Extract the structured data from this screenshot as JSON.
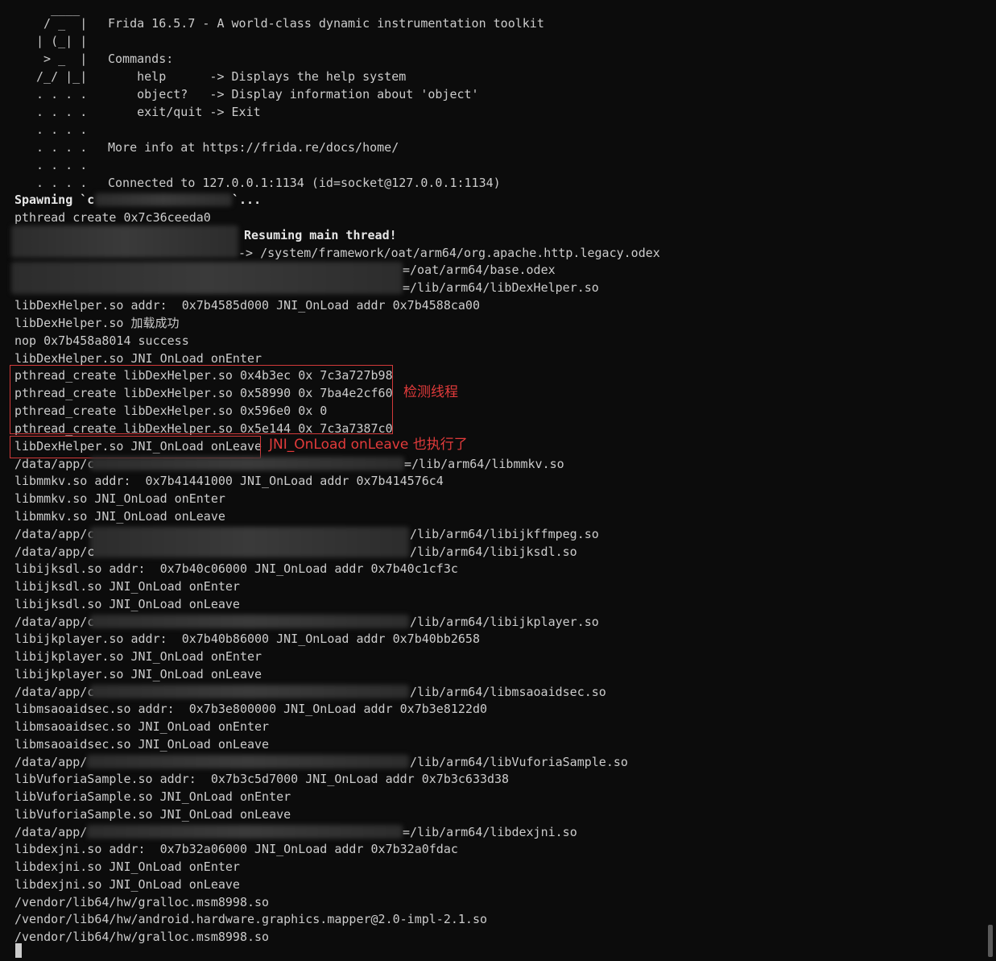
{
  "banner": {
    "ascii_art": [
      "   ____",
      "  / _  |",
      " | (_| |",
      "  > _  |",
      " /_/ |_|",
      " . . . .",
      " . . . .",
      " . . . .",
      " . . . .",
      " . . . .",
      " . . . ."
    ],
    "title": "Frida 16.5.7 - A world-class dynamic instrumentation toolkit",
    "commands_header": "Commands:",
    "commands": [
      "    help      -> Displays the help system",
      "    object?   -> Display information about 'object'",
      "    exit/quit -> Exit"
    ],
    "more_info": "More info at https://frida.re/docs/home/",
    "connected": "Connected to 127.0.0.1:1134 (id=socket@127.0.0.1:1134)"
  },
  "log": {
    "spawning_prefix": "Spawning `c",
    "spawning_suffix": "`...",
    "pthread_create": "pthread create 0x7c36ceeda0",
    "resuming": "Resuming main thread!",
    "legacy_odex": "-> /system/framework/oat/arm64/org.apache.http.legacy.odex",
    "base_odex": "=/oat/arm64/base.odex",
    "dexhelper_path": "=/lib/arm64/libDexHelper.so",
    "dexhelper_addr": "libDexHelper.so addr:  0x7b4585d000 JNI_OnLoad addr 0x7b4588ca00",
    "dexhelper_loaded": "libDexHelper.so 加载成功",
    "nop_line": "nop 0x7b458a8014 success",
    "dexhelper_onenter": "libDexHelper.so JNI_OnLoad onEnter",
    "pthread_lines": [
      "pthread_create libDexHelper.so 0x4b3ec 0x 7c3a727b98",
      "pthread_create libDexHelper.so 0x58990 0x 7ba4e2cf60",
      "pthread_create libDexHelper.so 0x596e0 0x 0",
      "pthread_create libDexHelper.so 0x5e144 0x 7c3a7387c0"
    ],
    "dexhelper_onleave": "libDexHelper.so JNI_OnLoad onLeave",
    "mmkv_prefix": "/data/app/c",
    "mmkv_suffix": "=/lib/arm64/libmmkv.so",
    "mmkv_addr": "libmmkv.so addr:  0x7b41441000 JNI_OnLoad addr 0x7b414576c4",
    "mmkv_onenter": "libmmkv.so JNI_OnLoad onEnter",
    "mmkv_onleave": "libmmkv.so JNI_OnLoad onLeave",
    "ffmpeg_prefix": "/data/app/c",
    "ffmpeg_suffix": "/lib/arm64/libijkffmpeg.so",
    "ijksdl_prefix": "/data/app/c",
    "ijksdl_suffix": "/lib/arm64/libijksdl.so",
    "ijksdl_addr": "libijksdl.so addr:  0x7b40c06000 JNI_OnLoad addr 0x7b40c1cf3c",
    "ijksdl_onenter": "libijksdl.so JNI_OnLoad onEnter",
    "ijksdl_onleave": "libijksdl.so JNI_OnLoad onLeave",
    "ijkplayer_prefix": "/data/app/c",
    "ijkplayer_suffix": "/lib/arm64/libijkplayer.so",
    "ijkplayer_addr": "libijkplayer.so addr:  0x7b40b86000 JNI_OnLoad addr 0x7b40bb2658",
    "ijkplayer_onenter": "libijkplayer.so JNI_OnLoad onEnter",
    "ijkplayer_onleave": "libijkplayer.so JNI_OnLoad onLeave",
    "msaoaidsec_prefix": "/data/app/c",
    "msaoaidsec_suffix": "/lib/arm64/libmsaoaidsec.so",
    "msaoaidsec_addr": "libmsaoaidsec.so addr:  0x7b3e800000 JNI_OnLoad addr 0x7b3e8122d0",
    "msaoaidsec_onenter": "libmsaoaidsec.so JNI_OnLoad onEnter",
    "msaoaidsec_onleave": "libmsaoaidsec.so JNI_OnLoad onLeave",
    "vuforia_prefix": "/data/app/",
    "vuforia_suffix": "/lib/arm64/libVuforiaSample.so",
    "vuforia_addr": "libVuforiaSample.so addr:  0x7b3c5d7000 JNI_OnLoad addr 0x7b3c633d38",
    "vuforia_onenter": "libVuforiaSample.so JNI_OnLoad onEnter",
    "vuforia_onleave": "libVuforiaSample.so JNI_OnLoad onLeave",
    "dexjni_prefix": "/data/app/",
    "dexjni_suffix": "=/lib/arm64/libdexjni.so",
    "dexjni_addr": "libdexjni.so addr:  0x7b32a06000 JNI_OnLoad addr 0x7b32a0fdac",
    "dexjni_onenter": "libdexjni.so JNI_OnLoad onEnter",
    "dexjni_onleave": "libdexjni.so JNI_OnLoad onLeave",
    "gralloc1": "/vendor/lib64/hw/gralloc.msm8998.so",
    "mapper": "/vendor/lib64/hw/android.hardware.graphics.mapper@2.0-impl-2.1.so",
    "gralloc2": "/vendor/lib64/hw/gralloc.msm8998.so"
  },
  "annotations": {
    "detect_threads": "检测线程",
    "onleave_note": "JNI_OnLoad onLeave 也执行了",
    "color": "#e23b3b"
  }
}
